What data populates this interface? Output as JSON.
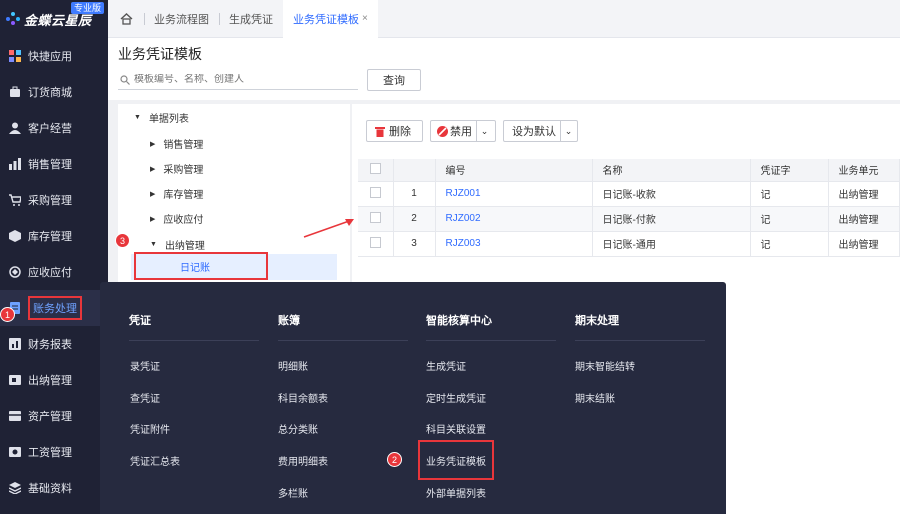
{
  "brand": {
    "name": "金蝶云星辰",
    "edition": "专业版"
  },
  "sidebar": {
    "items": [
      {
        "label": "快捷应用",
        "icon": "grid-icon"
      },
      {
        "label": "订货商城",
        "icon": "bag-icon"
      },
      {
        "label": "客户经营",
        "icon": "user-icon"
      },
      {
        "label": "销售管理",
        "icon": "chart-icon"
      },
      {
        "label": "采购管理",
        "icon": "cart-icon"
      },
      {
        "label": "库存管理",
        "icon": "box-icon"
      },
      {
        "label": "应收应付",
        "icon": "cycle-icon"
      },
      {
        "label": "账务处理",
        "icon": "ledger-icon"
      },
      {
        "label": "财务报表",
        "icon": "report-icon"
      },
      {
        "label": "出纳管理",
        "icon": "cash-icon"
      },
      {
        "label": "资产管理",
        "icon": "asset-icon"
      },
      {
        "label": "工资管理",
        "icon": "salary-icon"
      },
      {
        "label": "基础资料",
        "icon": "layers-icon"
      }
    ]
  },
  "tabs": [
    {
      "label": "业务流程图"
    },
    {
      "label": "生成凭证"
    },
    {
      "label": "业务凭证模板",
      "close": "×"
    }
  ],
  "page": {
    "title": "业务凭证模板",
    "search_placeholder": "模板编号、名称、创建人",
    "query_label": "查询"
  },
  "tree": {
    "root": "单据列表",
    "children": [
      "销售管理",
      "采购管理",
      "库存管理",
      "应收应付"
    ],
    "expanded": "出纳管理",
    "selected": "日记账"
  },
  "toolbar": {
    "delete": "删除",
    "disable": "禁用",
    "set_default": "设为默认"
  },
  "grid": {
    "headers": [
      "",
      "",
      "编号",
      "名称",
      "凭证字",
      "业务单元"
    ],
    "rows": [
      {
        "idx": "1",
        "code": "RJZ001",
        "name": "日记账-收款",
        "voucher": "记",
        "unit": "出纳管理"
      },
      {
        "idx": "2",
        "code": "RJZ002",
        "name": "日记账-付款",
        "voucher": "记",
        "unit": "出纳管理"
      },
      {
        "idx": "3",
        "code": "RJZ003",
        "name": "日记账-通用",
        "voucher": "记",
        "unit": "出纳管理"
      }
    ]
  },
  "menu": {
    "columns": [
      {
        "title": "凭证",
        "items": [
          "录凭证",
          "查凭证",
          "凭证附件",
          "凭证汇总表"
        ]
      },
      {
        "title": "账簿",
        "items": [
          "明细账",
          "科目余额表",
          "总分类账",
          "费用明细表",
          "多栏账"
        ]
      },
      {
        "title": "智能核算中心",
        "items": [
          "生成凭证",
          "定时生成凭证",
          "科目关联设置",
          "业务凭证模板",
          "外部单据列表"
        ]
      },
      {
        "title": "期末处理",
        "items": [
          "期末智能结转",
          "期末结账"
        ]
      }
    ]
  },
  "annotations": {
    "step1": "1",
    "step2": "2",
    "step3": "3"
  },
  "colors": {
    "accent": "#2f6bff",
    "highlight": "#e8363b",
    "sidebar": "#1f2235",
    "menu": "#262a3f"
  }
}
